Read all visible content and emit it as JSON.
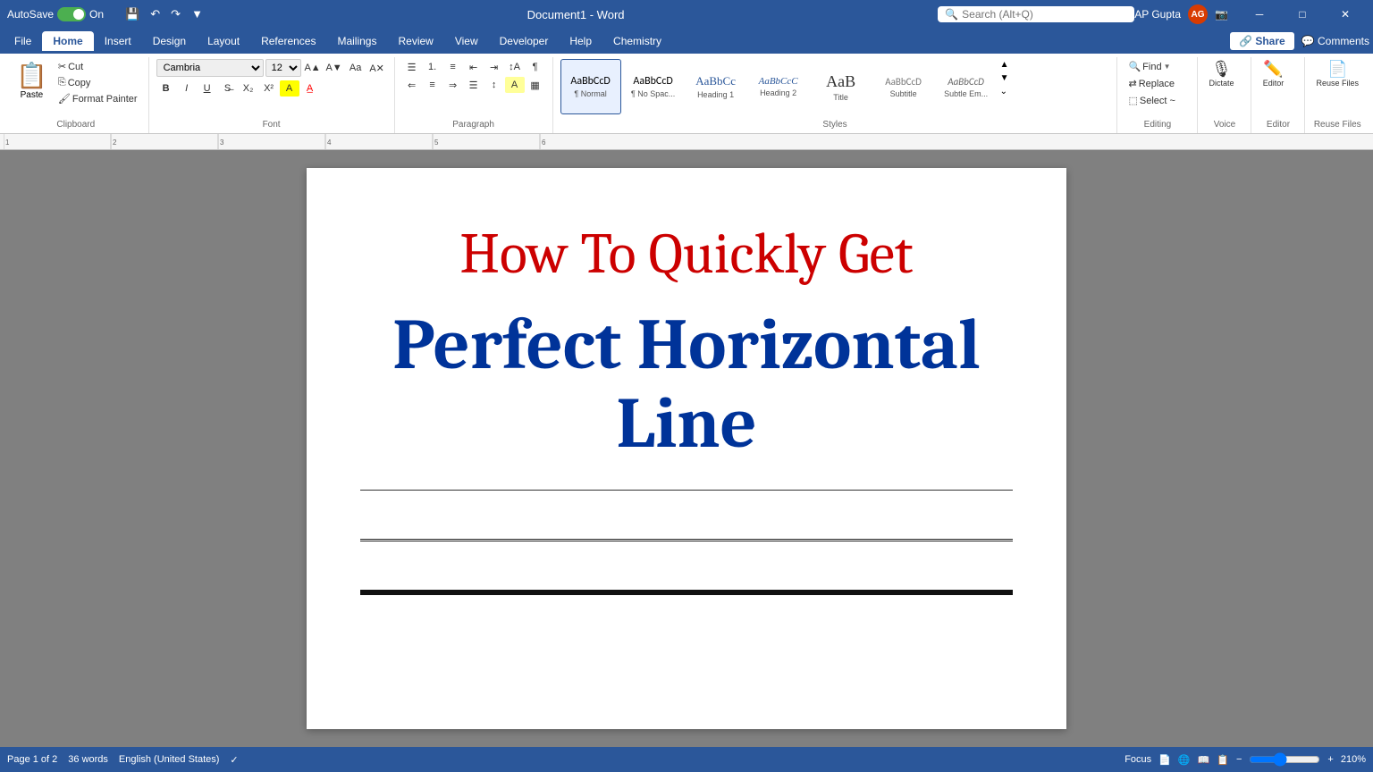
{
  "titlebar": {
    "autosave_label": "AutoSave",
    "autosave_state": "On",
    "doc_title": "Document1 - Word",
    "search_placeholder": "Search (Alt+Q)",
    "user_name": "AP Gupta",
    "user_initials": "AG"
  },
  "ribbon_tabs": {
    "items": [
      "File",
      "Home",
      "Insert",
      "Design",
      "Layout",
      "References",
      "Mailings",
      "Review",
      "View",
      "Developer",
      "Help",
      "Chemistry"
    ],
    "active": "Home",
    "share_label": "Share",
    "comments_label": "Comments"
  },
  "ribbon": {
    "clipboard": {
      "group_label": "Clipboard",
      "paste_label": "Paste",
      "cut_label": "Cut",
      "copy_label": "Copy",
      "format_painter_label": "Format Painter"
    },
    "font": {
      "group_label": "Font",
      "font_name": "Cambria",
      "font_size": "12",
      "bold_label": "B",
      "italic_label": "I",
      "underline_label": "U"
    },
    "paragraph": {
      "group_label": "Paragraph"
    },
    "styles": {
      "group_label": "Styles",
      "items": [
        {
          "name": "Normal",
          "preview": "AaBbCcD",
          "active": true
        },
        {
          "name": "No Spac...",
          "preview": "AaBbCcD",
          "active": false
        },
        {
          "name": "Heading 1",
          "preview": "AaBbCc",
          "active": false
        },
        {
          "name": "Heading 2",
          "preview": "AaBbCcC",
          "active": false
        },
        {
          "name": "Title",
          "preview": "AaB",
          "active": false
        },
        {
          "name": "Subtitle",
          "preview": "AaBbCcD",
          "active": false
        },
        {
          "name": "Subtle Em...",
          "preview": "AaBbCcD",
          "active": false
        }
      ]
    },
    "editing": {
      "group_label": "Editing",
      "find_label": "Find",
      "replace_label": "Replace",
      "select_label": "Select ~"
    },
    "voice": {
      "group_label": "Voice",
      "dictate_label": "Dictate"
    },
    "editor": {
      "group_label": "Editor",
      "editor_label": "Editor"
    },
    "reuse": {
      "group_label": "Reuse Files",
      "reuse_label": "Reuse Files"
    }
  },
  "document": {
    "title_line1": "How To Quickly Get",
    "title_line2": "Perfect Horizontal Line"
  },
  "statusbar": {
    "page_info": "Page 1 of 2",
    "words_label": "36 words",
    "language": "English (United States)",
    "view_label": "Focus",
    "zoom_level": "210%"
  }
}
